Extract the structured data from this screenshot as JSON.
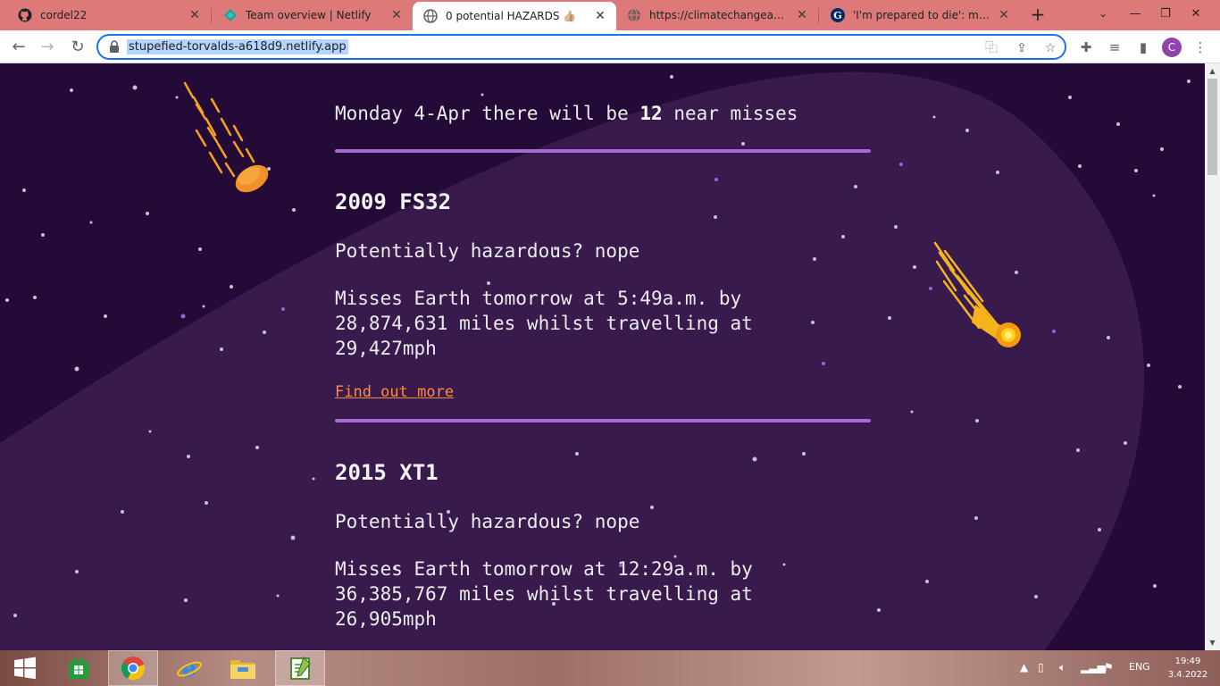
{
  "browser": {
    "tabs": [
      {
        "title": "cordel22",
        "icon": "github-icon",
        "active": false
      },
      {
        "title": "Team overview | Netlify",
        "icon": "netlify-icon",
        "active": false
      },
      {
        "title": "0 potential HAZARDS 👍🏼",
        "icon": "globe-icon",
        "active": true
      },
      {
        "title": "https://climatechangeapihere.h",
        "icon": "globe-icon",
        "active": false
      },
      {
        "title": "'I'm prepared to die': man on h",
        "icon": "guardian-icon",
        "active": false
      }
    ],
    "new_tab_label": "+",
    "url": "stupefied-torvalds-a618d9.netlify.app",
    "profile_initial": "C"
  },
  "page": {
    "headline": {
      "prefix": "Monday 4-Apr there will be",
      "count": "12",
      "suffix": "near misses"
    },
    "neos": [
      {
        "name": "2009 FS32",
        "hazard_text": "Potentially hazardous? nope",
        "description": "Misses Earth tomorrow at 5:49a.m. by 28,874,631 miles whilst travelling at 29,427mph",
        "link_label": "Find out more"
      },
      {
        "name": "2015 XT1",
        "hazard_text": "Potentially hazardous? nope",
        "description": "Misses Earth tomorrow at 12:29a.m. by 36,385,767 miles whilst travelling at 26,905mph"
      }
    ],
    "colors": {
      "background": "#240a36",
      "planet": "#3a1a4e",
      "rule": "#a56bd0",
      "link": "#ff8c3a",
      "comet_orange": "#f5a31c"
    }
  },
  "taskbar": {
    "apps": [
      "windows-start-icon",
      "store-icon",
      "chrome-icon",
      "internet-explorer-icon",
      "file-explorer-icon",
      "notepad-plus-plus-icon"
    ],
    "language": "ENG",
    "time": "19:49",
    "date": "3.4.2022"
  }
}
